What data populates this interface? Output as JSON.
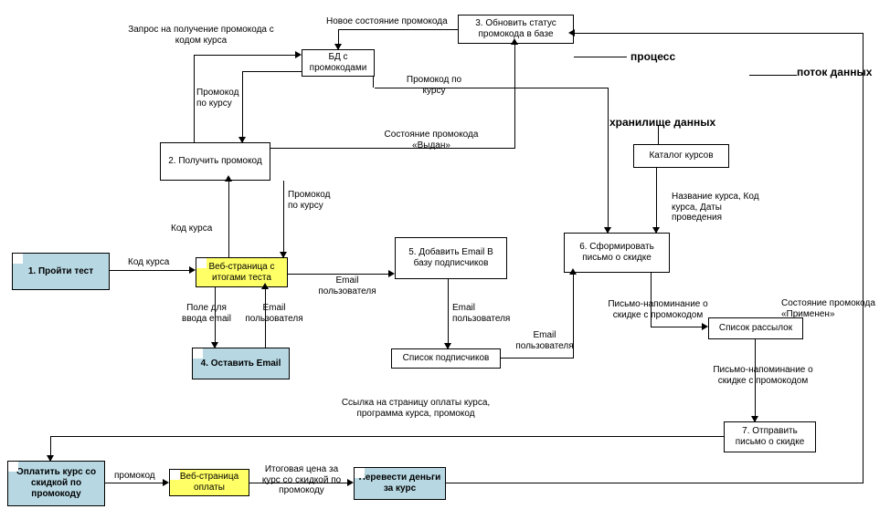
{
  "legend": {
    "process": "процесс",
    "dataflow": "поток данных",
    "datastore": "хранилище данных"
  },
  "boxes": {
    "b1": "1. Пройти тест",
    "b2": "2. Получить промокод",
    "b3": "3. Обновить статус промокода в базе",
    "b4": "4. Оставить Email",
    "b5": "5. Добавить Email В базу подписчиков",
    "b6": "6. Сформировать письмо о скидке",
    "b7": "7. Отправить письмо о скидке",
    "bd": "БД с промокодами",
    "katalog": "Каталог курсов",
    "spisok_podpis": "Список подписчиков",
    "spisok_rass": "Список рассылок",
    "web_itogi": "Веб-страница с итогами теста",
    "web_oplata": "Веб-страница оплаты",
    "oplatit": "Оплатить курс со скидкой по промокоду",
    "perevesti": "Перевести деньги за курс"
  },
  "labels": {
    "zapros": "Запрос на получение промокода с кодом курса",
    "promokod_kursu": "Промокод по курсу",
    "novoe_sost": "Новое состояние промокода",
    "sost_vydan": "Состояние промокода «Выдан»",
    "kod_kursa": "Код курса",
    "kod_kursa2": "Код курса",
    "pole_email": "Поле для ввода email",
    "email_polz": "Email пользователя",
    "email_polz2": "Email пользователя",
    "email_polz3": "Email пользователя",
    "email_polz4": "Email пользователя",
    "nazv_kursa": "Название курса, Код курса, Даты проведения",
    "pismo_napom": "Письмо-напоминание о скидке с промокодом",
    "pismo_napom2": "Письмо-напоминание о скидке с промокодом",
    "ssylka": "Ссылка на страницу оплаты курса, программа курса, промокод",
    "promokod": "промокод",
    "itog_cena": "Итоговая цена за курс со скидкой по промокоду",
    "sost_primenen": "Состояние промокода «Применен»"
  }
}
